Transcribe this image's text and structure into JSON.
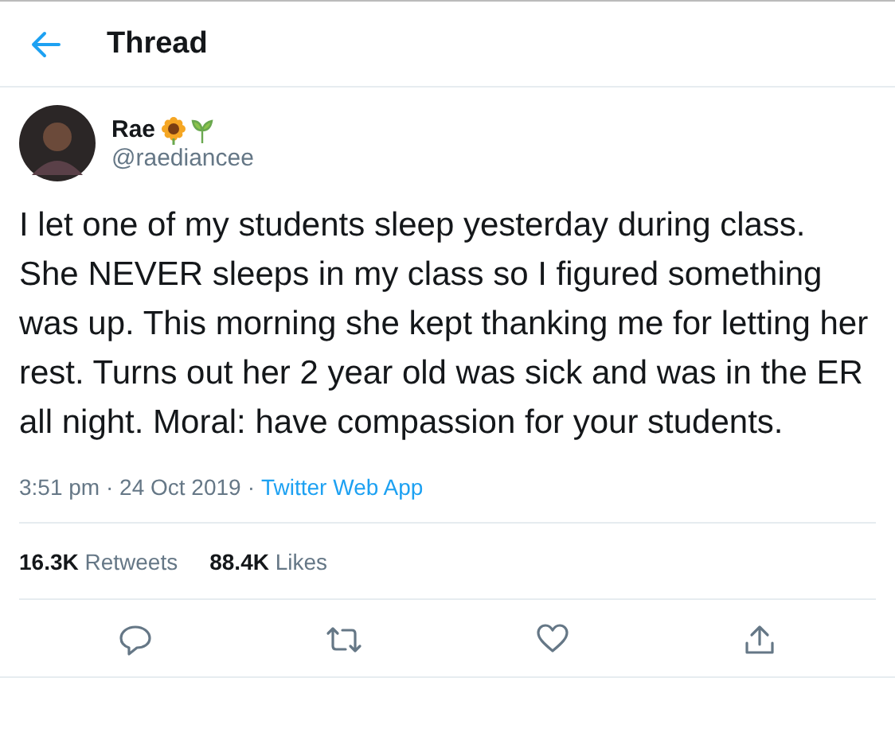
{
  "header": {
    "title": "Thread"
  },
  "tweet": {
    "name": "Rae",
    "handle": "@raediancee",
    "text": "I let one of my students sleep yesterday during class. She NEVER sleeps in my class so I figured something was up. This morning she kept thanking me for letting her rest. Turns out her 2 year old was sick and was in the ER all night. Moral: have compassion for your students.",
    "time": "3:51 pm · 24 Oct 2019",
    "separator": "·",
    "source": "Twitter Web App"
  },
  "stats": [
    {
      "count": "16.3K",
      "label": "Retweets"
    },
    {
      "count": "88.4K",
      "label": "Likes"
    }
  ]
}
